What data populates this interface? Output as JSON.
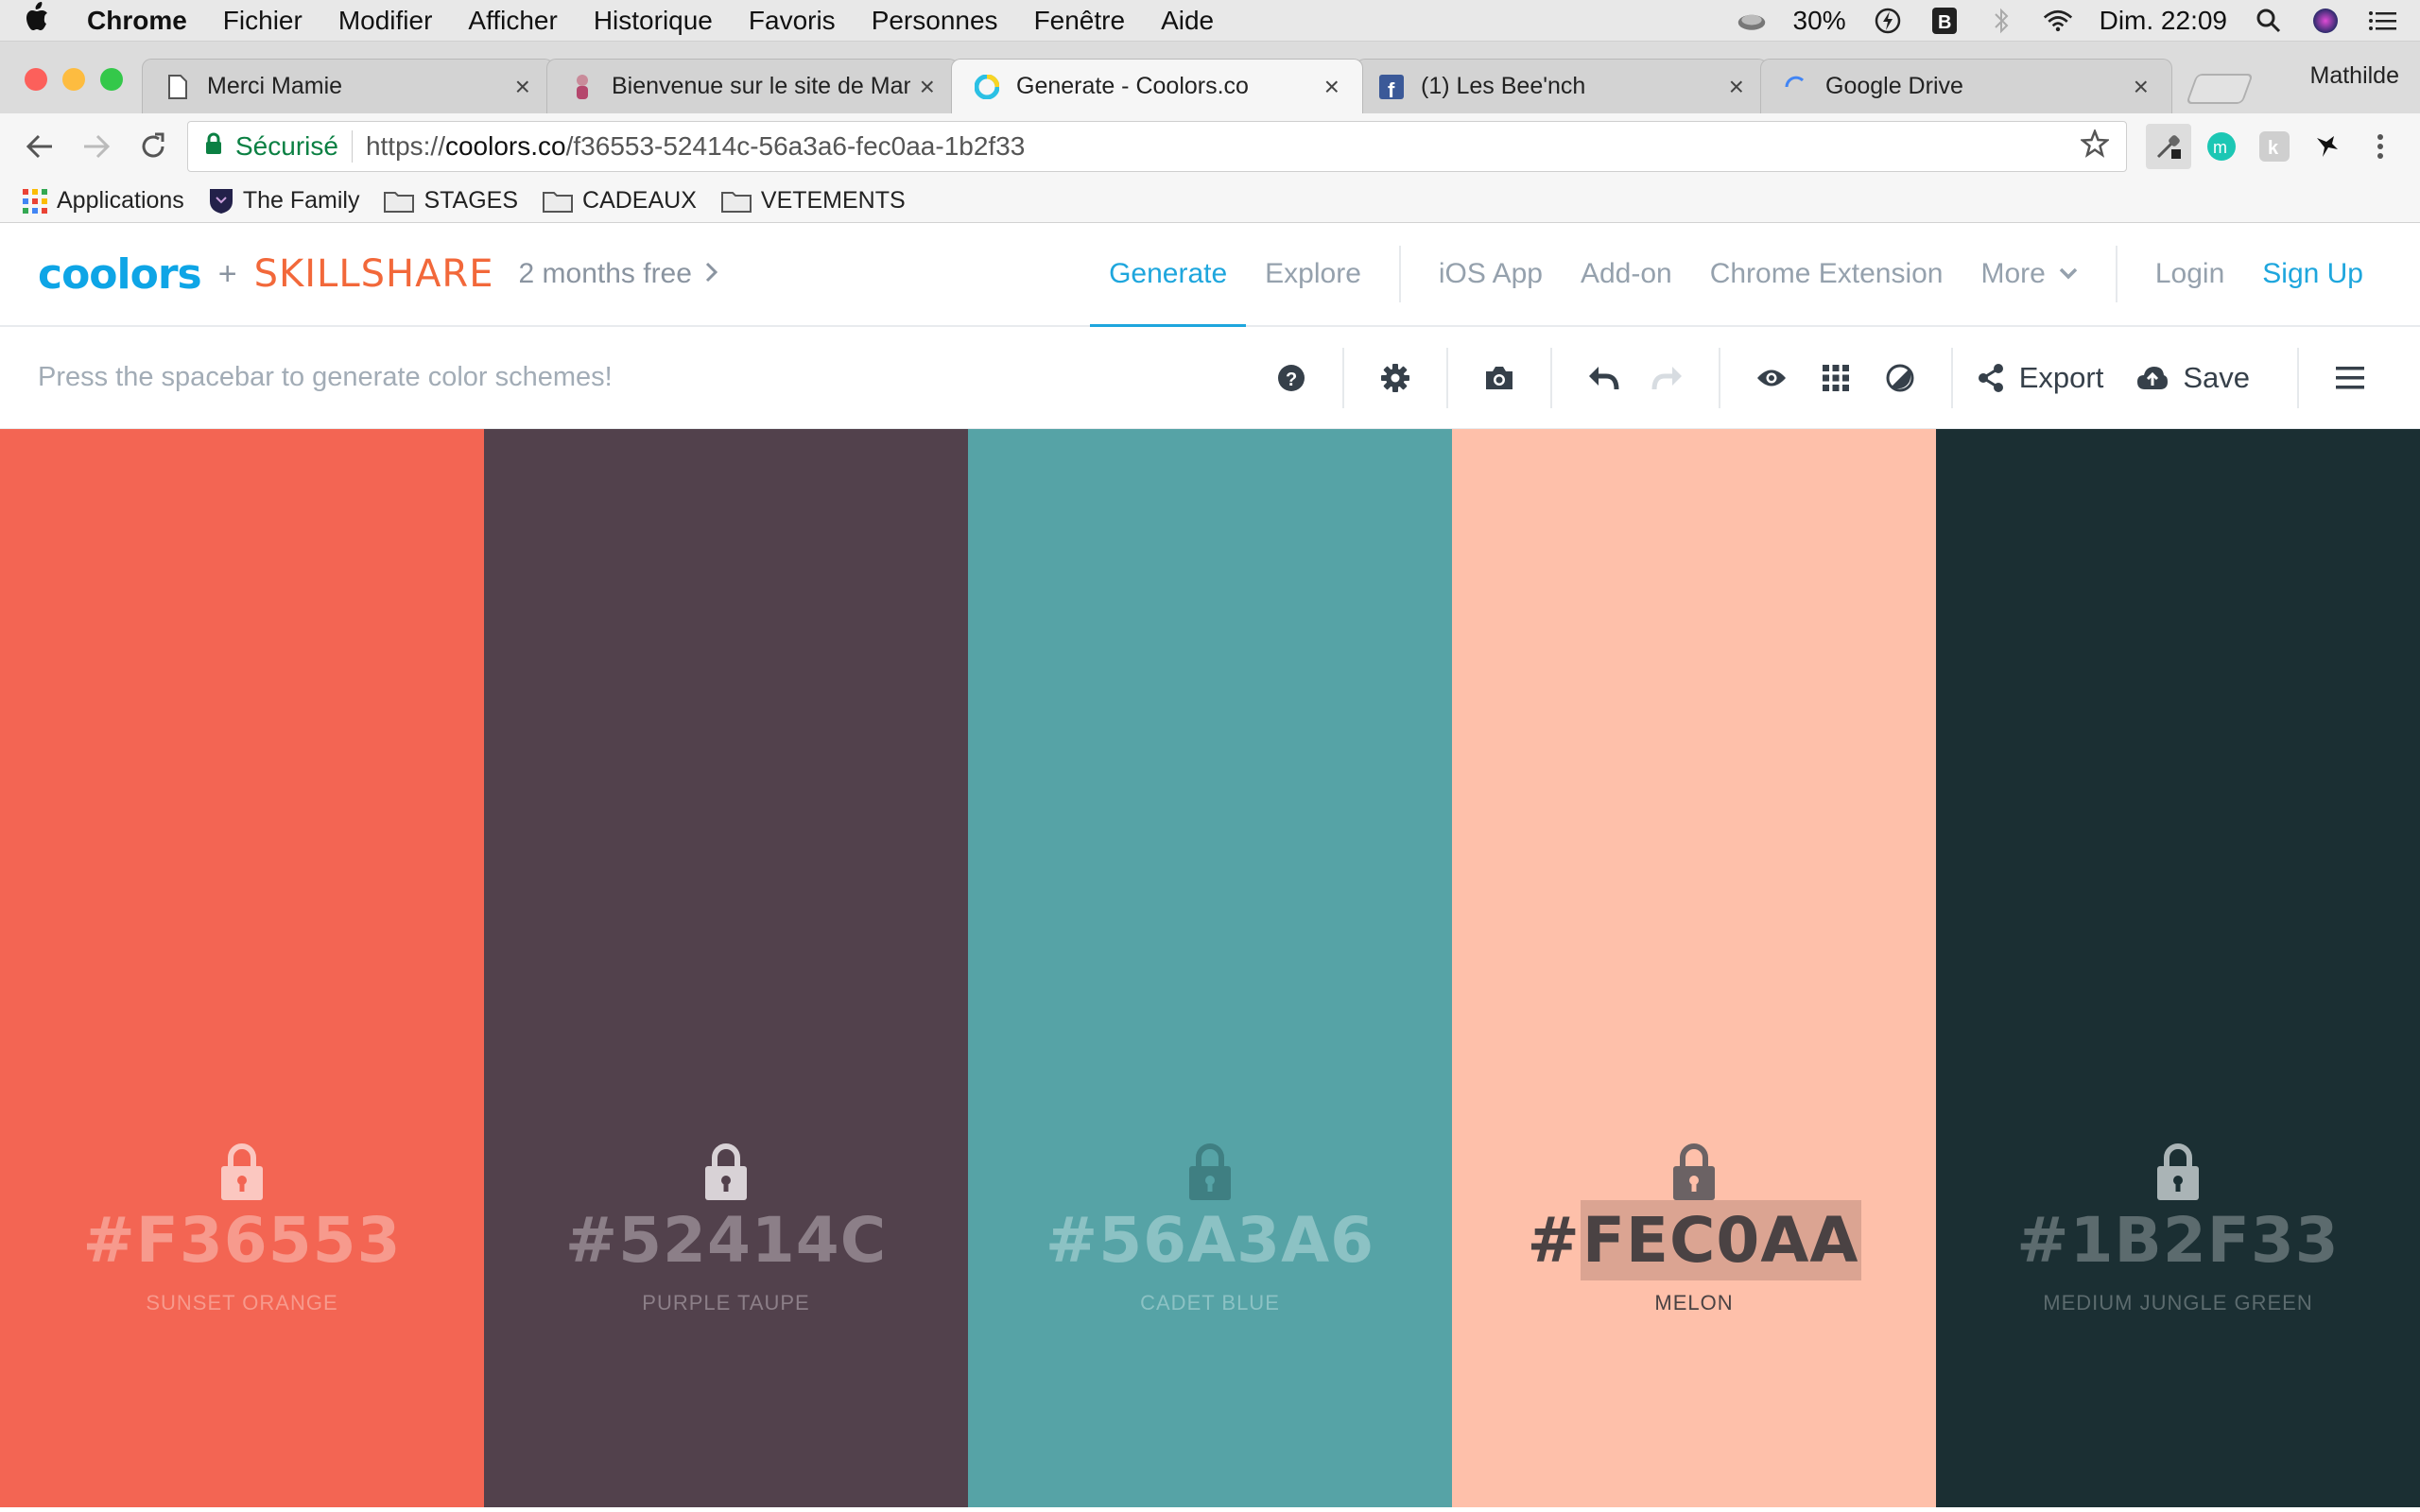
{
  "macos_menubar": {
    "app": "Chrome",
    "items": [
      "Fichier",
      "Modifier",
      "Afficher",
      "Historique",
      "Favoris",
      "Personnes",
      "Fenêtre",
      "Aide"
    ],
    "battery": "30%",
    "clock": "Dim. 22:09"
  },
  "browser": {
    "tabs": [
      {
        "title": "Merci Mamie",
        "active": false
      },
      {
        "title": "Bienvenue sur le site de Mam",
        "active": false
      },
      {
        "title": "Generate - Coolors.co",
        "active": true
      },
      {
        "title": "(1) Les Bee'nch",
        "active": false
      },
      {
        "title": "Google Drive",
        "active": false
      }
    ],
    "profile_name": "Mathilde",
    "omnibox": {
      "secure_label": "Sécurisé",
      "scheme": "https://",
      "host": "coolors.co",
      "path": "/f36553-52414c-56a3a6-fec0aa-1b2f33"
    },
    "bookmarks": [
      "Applications",
      "The Family",
      "STAGES",
      "CADEAUX",
      "VETEMENTS"
    ]
  },
  "header": {
    "logo": "coolors",
    "plus": "+",
    "partner": "SKILLSHARE",
    "promo": "2 months free",
    "nav": {
      "generate": "Generate",
      "explore": "Explore",
      "ios_app": "iOS App",
      "addon": "Add-on",
      "chrome_ext": "Chrome Extension",
      "more": "More",
      "login": "Login",
      "signup": "Sign Up"
    }
  },
  "toolbar": {
    "hint": "Press the spacebar to generate color schemes!",
    "export_label": "Export",
    "save_label": "Save"
  },
  "palette": [
    {
      "hex": "#F36553",
      "name": "SUNSET ORANGE",
      "bg": "#f36553",
      "text_color": "#f79a8d",
      "lock_color": "#fbc7c0"
    },
    {
      "hex": "#52414C",
      "name": "PURPLE TAUPE",
      "bg": "#52414c",
      "text_color": "#8c7f88",
      "lock_color": "#d8d2d6"
    },
    {
      "hex": "#56A3A6",
      "name": "CADET BLUE",
      "bg": "#56a3a6",
      "text_color": "#8cc2c4",
      "lock_color": "#3f7f82"
    },
    {
      "hex": "#FEC0AA",
      "name": "MELON",
      "bg": "#fec0aa",
      "text_color": "#4a4243",
      "lock_color": "#6b6264",
      "hex_prefix": "#",
      "hex_selected": "FEC0AA"
    },
    {
      "hex": "#1B2F33",
      "name": "MEDIUM JUNGLE GREEN",
      "bg": "#1b2f33",
      "text_color": "#5c6b6e",
      "lock_color": "#aab4b6"
    }
  ]
}
